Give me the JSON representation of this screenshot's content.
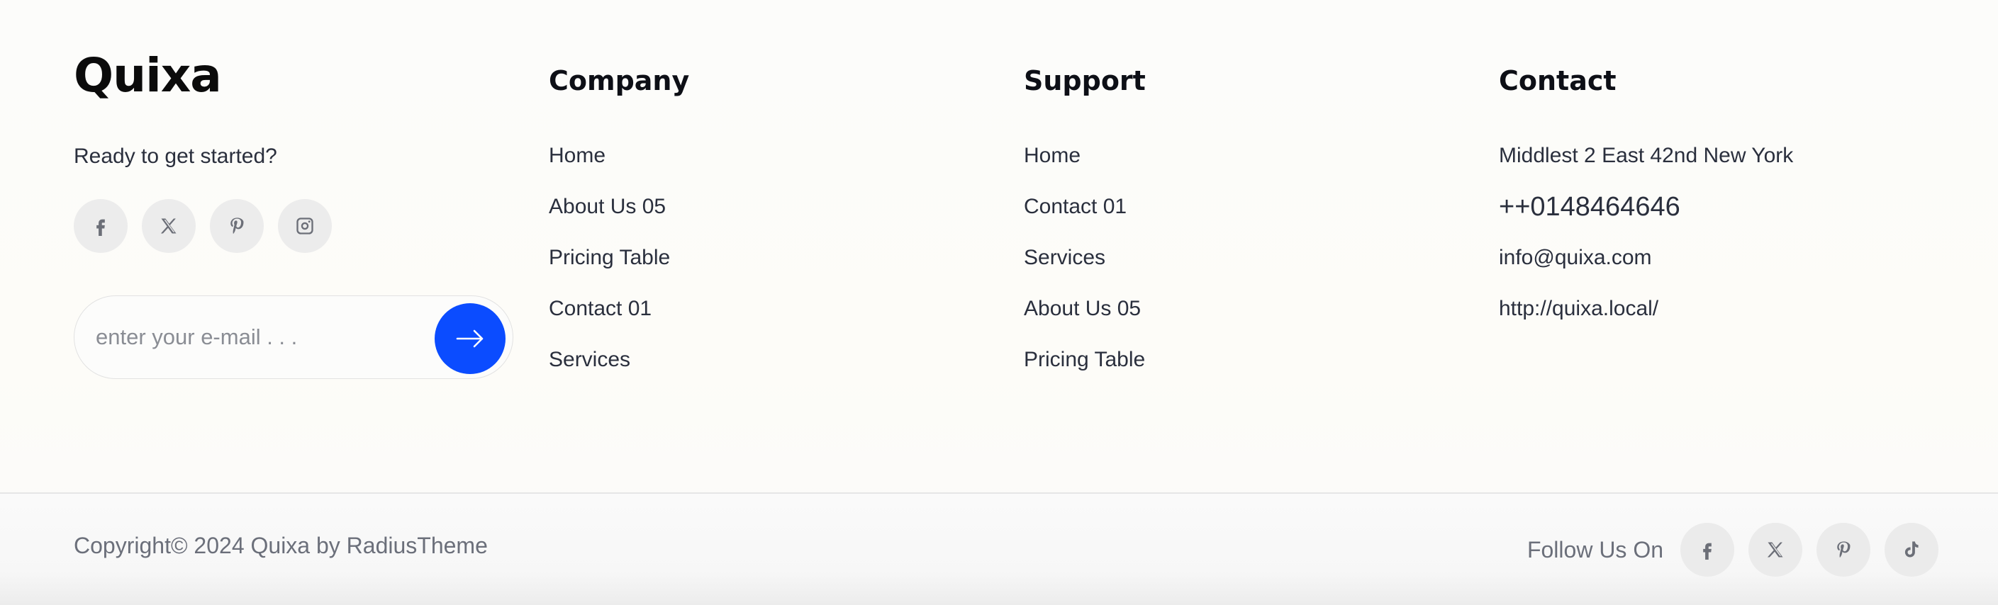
{
  "brand": {
    "logo": "Quixa",
    "tagline": "Ready to get started?",
    "socials": [
      "facebook-icon",
      "x-twitter-icon",
      "pinterest-icon",
      "instagram-icon"
    ],
    "subscribe": {
      "placeholder": "enter your e-mail . . .",
      "button_icon": "arrow-right-icon",
      "button_color": "#0b4cff"
    }
  },
  "company": {
    "title": "Company",
    "links": [
      "Home",
      "About Us 05",
      "Pricing Table",
      "Contact 01",
      "Services"
    ]
  },
  "support": {
    "title": "Support",
    "links": [
      "Home",
      "Contact 01",
      "Services",
      "About Us 05",
      "Pricing Table"
    ]
  },
  "contact": {
    "title": "Contact",
    "address": "Middlest 2 East 42nd New York",
    "phone": "++0148464646",
    "email": "info@quixa.com",
    "website": "http://quixa.local/"
  },
  "bottom": {
    "copyright": "Copyright© 2024 Quixa by RadiusTheme",
    "follow_label": "Follow Us On",
    "socials": [
      "facebook-icon",
      "x-twitter-icon",
      "pinterest-icon",
      "tiktok-icon"
    ]
  }
}
